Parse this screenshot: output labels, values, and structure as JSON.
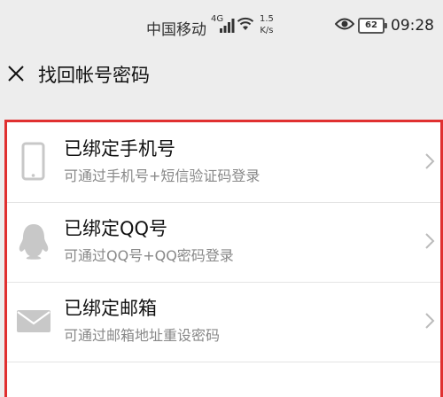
{
  "status_bar": {
    "carrier": "中国移动",
    "network": "4G",
    "speed_value": "1.5",
    "speed_unit": "K/s",
    "battery": "62",
    "time": "09:28"
  },
  "header": {
    "title": "找回帐号密码",
    "close_icon": "close-icon"
  },
  "options": [
    {
      "title": "已绑定手机号",
      "subtitle": "可通过手机号+短信验证码登录",
      "icon": "phone-icon"
    },
    {
      "title": "已绑定QQ号",
      "subtitle": "可通过QQ号+QQ密码登录",
      "icon": "qq-penguin-icon"
    },
    {
      "title": "已绑定邮箱",
      "subtitle": "可通过邮箱地址重设密码",
      "icon": "mail-icon"
    }
  ],
  "colors": {
    "highlight_border": "#e03030",
    "background": "#ededed",
    "icon_gray": "#c8c8c8",
    "subtitle_gray": "#888888"
  }
}
